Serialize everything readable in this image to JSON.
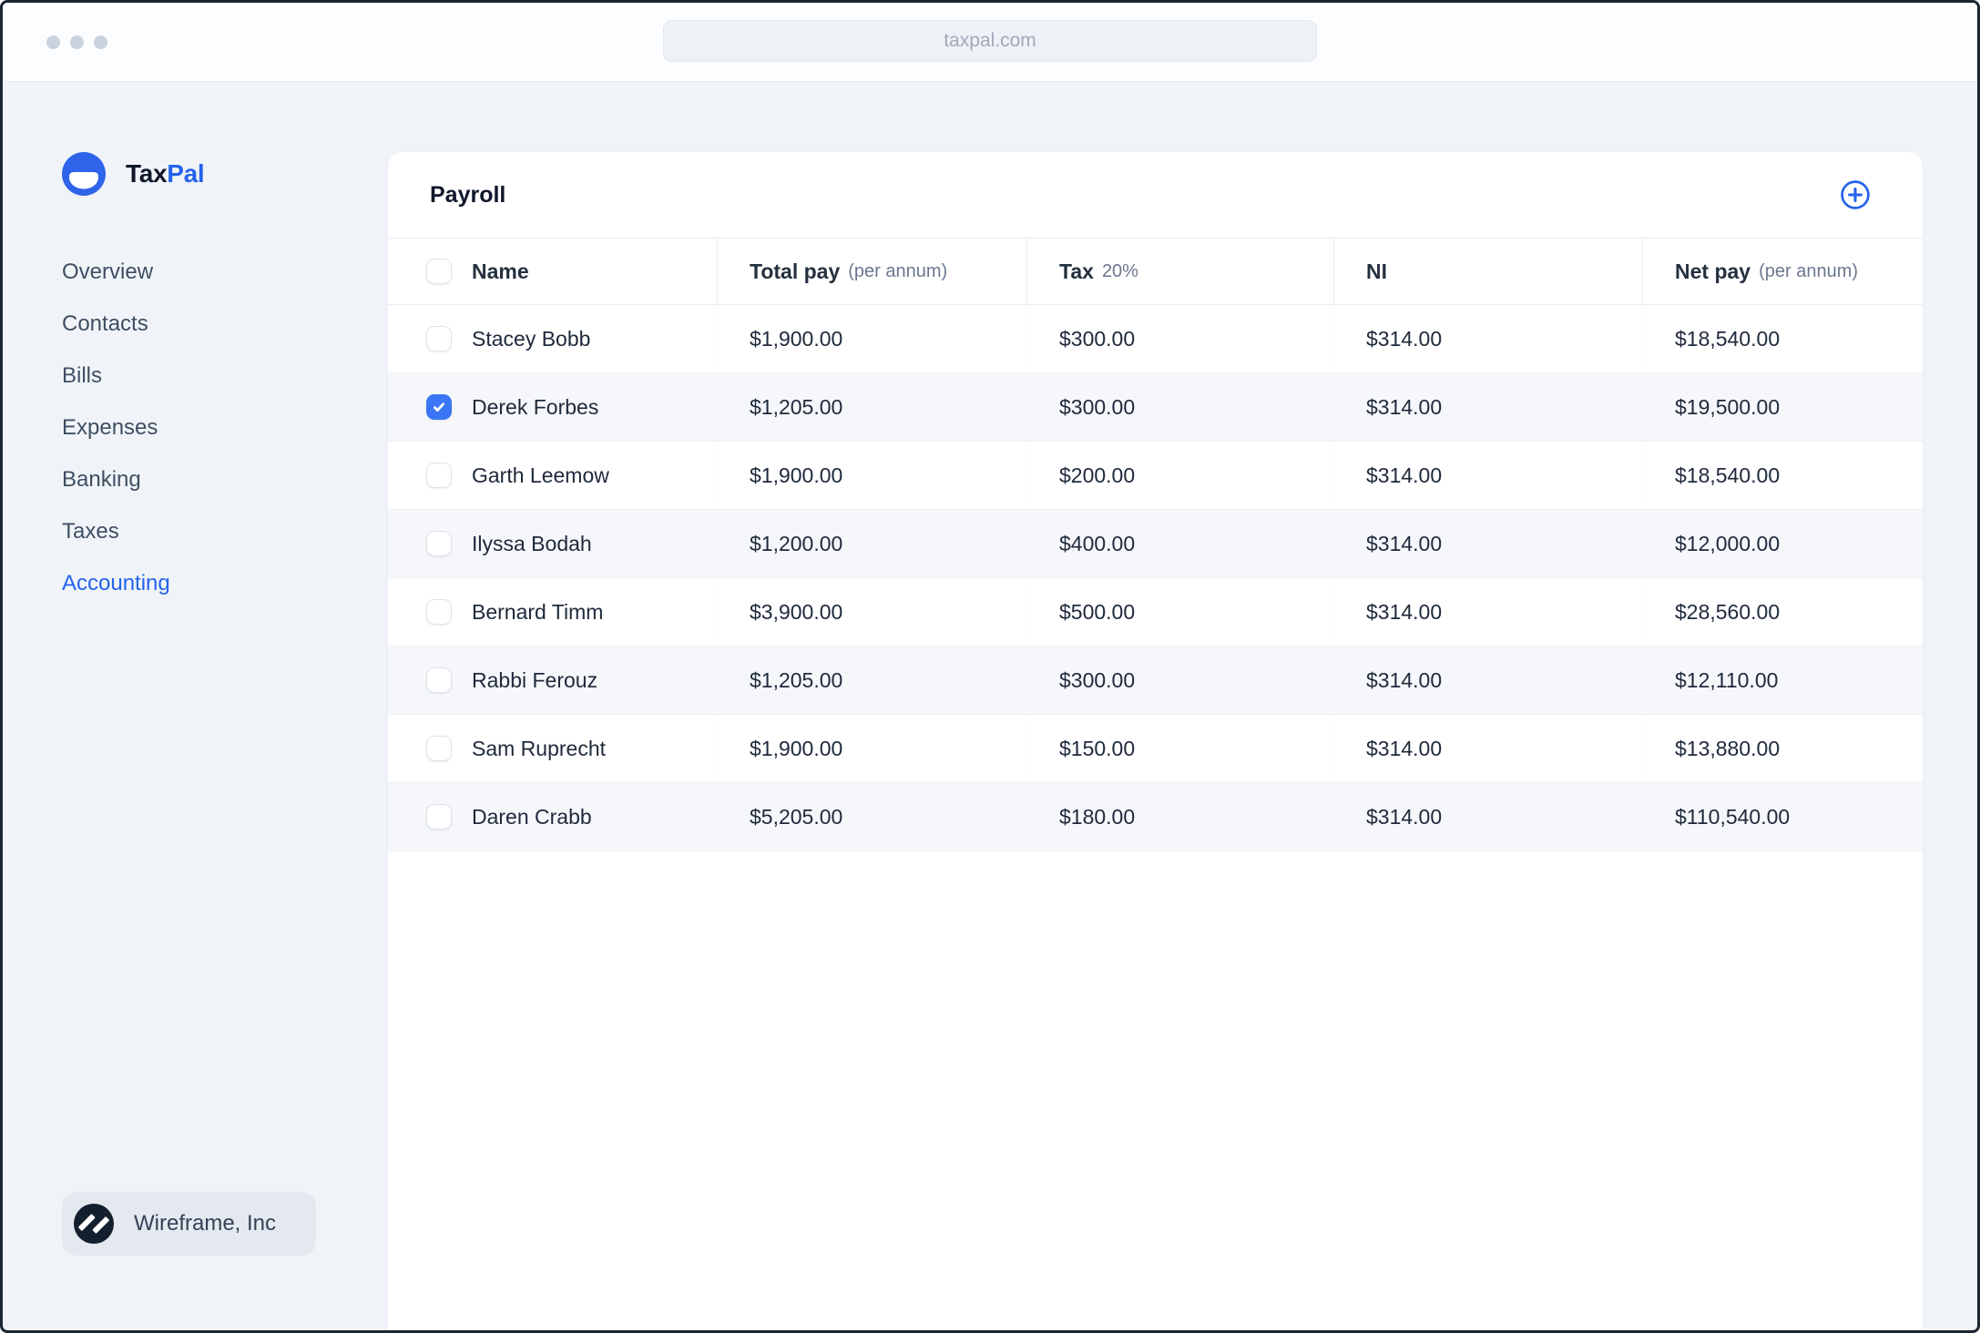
{
  "browser": {
    "url": "taxpal.com"
  },
  "sidebar": {
    "logo": {
      "brand_primary": "Tax",
      "brand_accent": "Pal"
    },
    "items": [
      {
        "label": "Overview",
        "active": false
      },
      {
        "label": "Contacts",
        "active": false
      },
      {
        "label": "Bills",
        "active": false
      },
      {
        "label": "Expenses",
        "active": false
      },
      {
        "label": "Banking",
        "active": false
      },
      {
        "label": "Taxes",
        "active": false
      },
      {
        "label": "Accounting",
        "active": true
      }
    ],
    "footer": {
      "company": "Wireframe, Inc"
    }
  },
  "main": {
    "title": "Payroll",
    "table": {
      "columns": [
        {
          "label": "Name",
          "sub": ""
        },
        {
          "label": "Total pay",
          "sub": "(per annum)"
        },
        {
          "label": "Tax",
          "sub": "20%"
        },
        {
          "label": "NI",
          "sub": ""
        },
        {
          "label": "Net pay",
          "sub": "(per annum)"
        }
      ],
      "rows": [
        {
          "name": "Stacey Bobb",
          "total_pay": "$1,900.00",
          "tax": "$300.00",
          "ni": "$314.00",
          "net_pay": "$18,540.00",
          "checked": false
        },
        {
          "name": "Derek Forbes",
          "total_pay": "$1,205.00",
          "tax": "$300.00",
          "ni": "$314.00",
          "net_pay": "$19,500.00",
          "checked": true
        },
        {
          "name": "Garth Leemow",
          "total_pay": "$1,900.00",
          "tax": "$200.00",
          "ni": "$314.00",
          "net_pay": "$18,540.00",
          "checked": false
        },
        {
          "name": "Ilyssa Bodah",
          "total_pay": "$1,200.00",
          "tax": "$400.00",
          "ni": "$314.00",
          "net_pay": "$12,000.00",
          "checked": false
        },
        {
          "name": "Bernard Timm",
          "total_pay": "$3,900.00",
          "tax": "$500.00",
          "ni": "$314.00",
          "net_pay": "$28,560.00",
          "checked": false
        },
        {
          "name": "Rabbi Ferouz",
          "total_pay": "$1,205.00",
          "tax": "$300.00",
          "ni": "$314.00",
          "net_pay": "$12,110.00",
          "checked": false
        },
        {
          "name": "Sam Ruprecht",
          "total_pay": "$1,900.00",
          "tax": "$150.00",
          "ni": "$314.00",
          "net_pay": "$13,880.00",
          "checked": false
        },
        {
          "name": "Daren Crabb",
          "total_pay": "$5,205.00",
          "tax": "$180.00",
          "ni": "$314.00",
          "net_pay": "$110,540.00",
          "checked": false
        }
      ]
    }
  },
  "colors": {
    "accent": "#2563eb",
    "checkbox-blue": "#3b76f6",
    "text-dark": "#1e293b",
    "page-bg": "#f0f4f8"
  }
}
